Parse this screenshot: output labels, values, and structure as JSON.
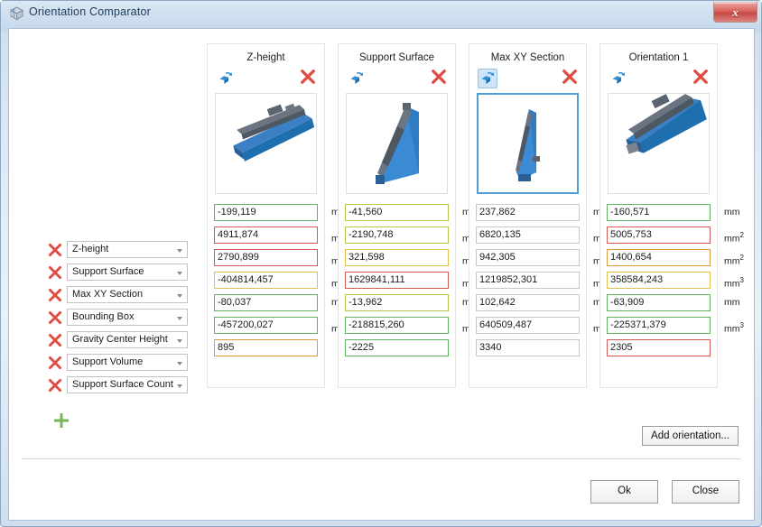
{
  "window": {
    "title": "Orientation Comparator",
    "icon": "comparator-icon",
    "close_label": "x"
  },
  "criteria": {
    "rows": [
      {
        "label": "Z-height",
        "unit": "mm",
        "unit_sup": ""
      },
      {
        "label": "Support Surface",
        "unit": "mm",
        "unit_sup": "2"
      },
      {
        "label": "Max XY Section",
        "unit": "mm",
        "unit_sup": "2"
      },
      {
        "label": "Bounding Box",
        "unit": "mm",
        "unit_sup": "3"
      },
      {
        "label": "Gravity Center Height",
        "unit": "mm",
        "unit_sup": ""
      },
      {
        "label": "Support Volume",
        "unit": "mm",
        "unit_sup": "3"
      },
      {
        "label": "Support Surface Count",
        "unit": "",
        "unit_sup": ""
      }
    ],
    "add_label": "+"
  },
  "columns": [
    {
      "title": "Z-height",
      "thumb_selected": false,
      "rotate_selected": false,
      "values": [
        {
          "text": "-199,119",
          "border": "b-green"
        },
        {
          "text": "4911,874",
          "border": "b-red"
        },
        {
          "text": "2790,899",
          "border": "b-red"
        },
        {
          "text": "-404814,457",
          "border": "b-yellow"
        },
        {
          "text": "-80,037",
          "border": "b-green"
        },
        {
          "text": "-457200,027",
          "border": "b-green"
        },
        {
          "text": "895",
          "border": "b-orange"
        }
      ]
    },
    {
      "title": "Support Surface",
      "thumb_selected": false,
      "rotate_selected": false,
      "values": [
        {
          "text": "-41,560",
          "border": "b-olive"
        },
        {
          "text": "-2190,748",
          "border": "b-olive"
        },
        {
          "text": "321,598",
          "border": "b-yellow"
        },
        {
          "text": "1629841,111",
          "border": "b-red"
        },
        {
          "text": "-13,962",
          "border": "b-olive"
        },
        {
          "text": "-218815,260",
          "border": "b-green"
        },
        {
          "text": "-2225",
          "border": "b-green"
        }
      ]
    },
    {
      "title": "Max XY Section",
      "thumb_selected": true,
      "rotate_selected": true,
      "values": [
        {
          "text": "237,862",
          "border": "b-gray"
        },
        {
          "text": "6820,135",
          "border": "b-gray"
        },
        {
          "text": "942,305",
          "border": "b-gray"
        },
        {
          "text": "1219852,301",
          "border": "b-gray"
        },
        {
          "text": "102,642",
          "border": "b-gray"
        },
        {
          "text": "640509,487",
          "border": "b-gray"
        },
        {
          "text": "3340",
          "border": "b-gray"
        }
      ]
    },
    {
      "title": "Orientation 1",
      "thumb_selected": false,
      "rotate_selected": false,
      "values": [
        {
          "text": "-160,571",
          "border": "b-green"
        },
        {
          "text": "5005,753",
          "border": "b-red"
        },
        {
          "text": "1400,654",
          "border": "b-orange"
        },
        {
          "text": "358584,243",
          "border": "b-yellow"
        },
        {
          "text": "-63,909",
          "border": "b-green"
        },
        {
          "text": "-225371,379",
          "border": "b-green"
        },
        {
          "text": "2305",
          "border": "b-red"
        }
      ]
    }
  ],
  "actions": {
    "add_orientation_label": "Add orientation...",
    "ok_label": "Ok",
    "close_label": "Close"
  },
  "colors": {
    "accent_blue": "#2f8fd4",
    "delete_red": "#e04b42",
    "add_green": "#77b558",
    "selection_blue": "#4f9fd4"
  }
}
